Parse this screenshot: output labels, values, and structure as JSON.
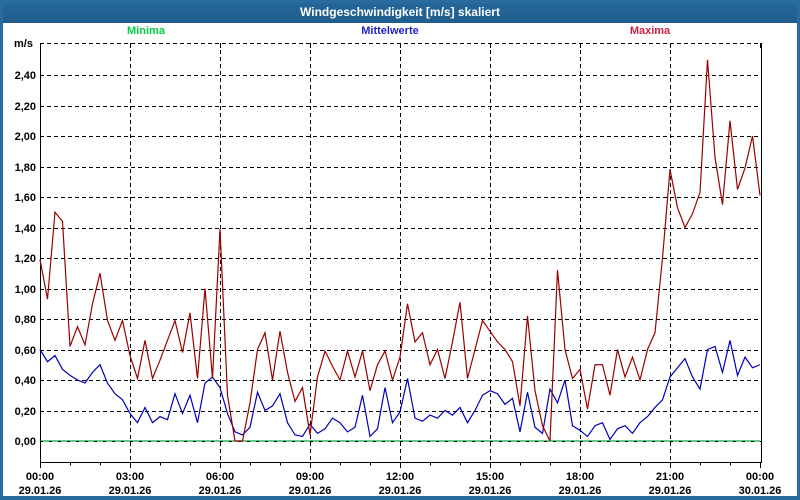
{
  "window": {
    "title": "Windgeschwindigkeit [m/s] skaliert",
    "titlebar_color": "#26699C",
    "border_color": "#2A6B9E",
    "background_color": "#FFFFFF"
  },
  "legend": {
    "items": [
      {
        "label": "Minima",
        "color": "#00CC44"
      },
      {
        "label": "Mittelwerte",
        "color": "#2222CC"
      },
      {
        "label": "Maxima",
        "color": "#CC2244"
      }
    ]
  },
  "chart_data": {
    "type": "line",
    "title": "Windgeschwindigkeit [m/s] skaliert",
    "ylabel_unit": "m/s",
    "ylim": [
      0,
      2.58
    ],
    "xlim_hours": [
      0,
      24
    ],
    "grid": "dashed",
    "legend_position": "top",
    "x_interval_minutes": 15,
    "x_ticks": [
      {
        "hour": 0,
        "time": "00:00",
        "date": "29.01.26"
      },
      {
        "hour": 3,
        "time": "03:00",
        "date": "29.01.26"
      },
      {
        "hour": 6,
        "time": "06:00",
        "date": "29.01.26"
      },
      {
        "hour": 9,
        "time": "09:00",
        "date": "29.01.26"
      },
      {
        "hour": 12,
        "time": "12:00",
        "date": "29.01.26"
      },
      {
        "hour": 15,
        "time": "15:00",
        "date": "29.01.26"
      },
      {
        "hour": 18,
        "time": "18:00",
        "date": "29.01.26"
      },
      {
        "hour": 21,
        "time": "21:00",
        "date": "29.01.26"
      },
      {
        "hour": 24,
        "time": "00:00",
        "date": "30.01.26"
      }
    ],
    "y_ticks": [
      {
        "value": 0.0,
        "label": "0,00"
      },
      {
        "value": 0.2,
        "label": "0,20"
      },
      {
        "value": 0.4,
        "label": "0,40"
      },
      {
        "value": 0.6,
        "label": "0,60"
      },
      {
        "value": 0.8,
        "label": "0,80"
      },
      {
        "value": 1.0,
        "label": "1,00"
      },
      {
        "value": 1.2,
        "label": "1,20"
      },
      {
        "value": 1.4,
        "label": "1,40"
      },
      {
        "value": 1.6,
        "label": "1,60"
      },
      {
        "value": 1.8,
        "label": "1,80"
      },
      {
        "value": 2.0,
        "label": "2,00"
      },
      {
        "value": 2.2,
        "label": "2,20"
      },
      {
        "value": 2.4,
        "label": "2,40"
      }
    ],
    "zero_line_color": "#00AA44",
    "series": [
      {
        "name": "Minima",
        "color": "#00AA44",
        "constant_value": 0.0
      },
      {
        "name": "Mittelwerte",
        "color": "#0000BB",
        "values": [
          0.6,
          0.52,
          0.56,
          0.47,
          0.43,
          0.4,
          0.38,
          0.45,
          0.5,
          0.38,
          0.31,
          0.27,
          0.18,
          0.12,
          0.22,
          0.12,
          0.16,
          0.14,
          0.31,
          0.18,
          0.3,
          0.12,
          0.38,
          0.42,
          0.35,
          0.18,
          0.06,
          0.04,
          0.09,
          0.32,
          0.2,
          0.23,
          0.31,
          0.12,
          0.04,
          0.03,
          0.11,
          0.05,
          0.08,
          0.15,
          0.12,
          0.06,
          0.09,
          0.3,
          0.03,
          0.08,
          0.35,
          0.12,
          0.19,
          0.41,
          0.15,
          0.13,
          0.17,
          0.15,
          0.2,
          0.17,
          0.22,
          0.12,
          0.2,
          0.3,
          0.33,
          0.31,
          0.24,
          0.28,
          0.06,
          0.32,
          0.09,
          0.05,
          0.34,
          0.25,
          0.4,
          0.1,
          0.07,
          0.03,
          0.1,
          0.12,
          0.01,
          0.08,
          0.1,
          0.05,
          0.12,
          0.16,
          0.22,
          0.27,
          0.42,
          0.48,
          0.54,
          0.42,
          0.34,
          0.6,
          0.62,
          0.45,
          0.66,
          0.43,
          0.55,
          0.48,
          0.5
        ]
      },
      {
        "name": "Maxima",
        "color": "#990000",
        "values": [
          1.19,
          0.93,
          1.5,
          1.44,
          0.62,
          0.75,
          0.63,
          0.9,
          1.1,
          0.79,
          0.66,
          0.79,
          0.56,
          0.41,
          0.66,
          0.41,
          0.53,
          0.66,
          0.79,
          0.58,
          0.84,
          0.41,
          1.0,
          0.41,
          1.39,
          0.3,
          0.0,
          0.0,
          0.25,
          0.6,
          0.71,
          0.4,
          0.72,
          0.45,
          0.26,
          0.35,
          0.04,
          0.42,
          0.59,
          0.49,
          0.4,
          0.59,
          0.42,
          0.59,
          0.33,
          0.5,
          0.59,
          0.4,
          0.55,
          0.9,
          0.65,
          0.71,
          0.5,
          0.6,
          0.41,
          0.65,
          0.91,
          0.41,
          0.6,
          0.79,
          0.72,
          0.65,
          0.6,
          0.52,
          0.23,
          0.82,
          0.33,
          0.1,
          0.0,
          1.12,
          0.6,
          0.41,
          0.47,
          0.21,
          0.5,
          0.5,
          0.3,
          0.6,
          0.42,
          0.55,
          0.4,
          0.6,
          0.71,
          1.2,
          1.78,
          1.53,
          1.4,
          1.49,
          1.63,
          2.5,
          1.86,
          1.55,
          2.1,
          1.65,
          1.79,
          2.0,
          1.61
        ]
      }
    ]
  }
}
